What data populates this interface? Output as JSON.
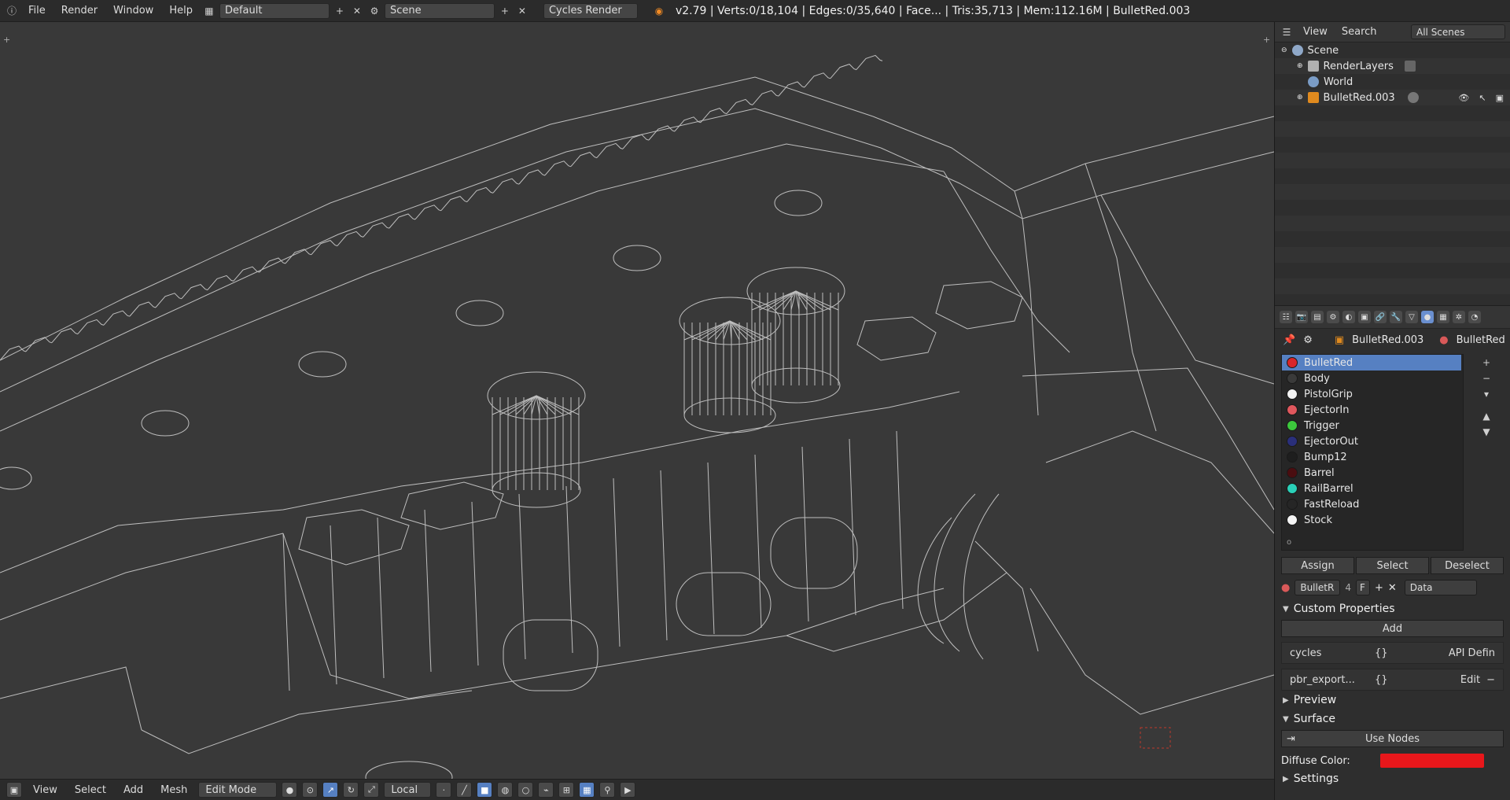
{
  "topbar": {
    "menus": [
      "File",
      "Render",
      "Window",
      "Help"
    ],
    "layout": "Default",
    "scene": "Scene",
    "engine": "Cycles Render",
    "stats": "v2.79 | Verts:0/18,104 | Edges:0/35,640 | Face... | Tris:35,713 | Mem:112.16M | BulletRed.003"
  },
  "outliner": {
    "menus": [
      "View",
      "Search"
    ],
    "scope": "All Scenes",
    "items": [
      {
        "label": "Scene"
      },
      {
        "label": "RenderLayers"
      },
      {
        "label": "World"
      },
      {
        "label": "BulletRed.003"
      }
    ]
  },
  "properties": {
    "context_object": "BulletRed.003",
    "context_material": "BulletRed",
    "materials": [
      {
        "label": "BulletRed",
        "color": "#d8262a"
      },
      {
        "label": "Body",
        "color": "#3a3a3a"
      },
      {
        "label": "PistolGrip",
        "color": "#f2f2f2"
      },
      {
        "label": "EjectorIn",
        "color": "#e0575d"
      },
      {
        "label": "Trigger",
        "color": "#3cc83c"
      },
      {
        "label": "EjectorOut",
        "color": "#2a2f7a"
      },
      {
        "label": "Bump12",
        "color": "#1e1e1e"
      },
      {
        "label": "Barrel",
        "color": "#4a0d10"
      },
      {
        "label": "RailBarrel",
        "color": "#2ad0b8"
      },
      {
        "label": "FastReload",
        "color": "#262626"
      },
      {
        "label": "Stock",
        "color": "#f5f5f5"
      }
    ],
    "buttons": {
      "assign": "Assign",
      "select": "Select",
      "deselect": "Deselect"
    },
    "datablock": {
      "name": "BulletR",
      "users": "4",
      "fake": "F",
      "link": "Data"
    },
    "custom_props": {
      "title": "Custom Properties",
      "add": "Add",
      "rows": [
        {
          "name": "cycles",
          "value": "{}",
          "extra": "API Defin"
        },
        {
          "name": "pbr_export...",
          "value": "{}",
          "extra": "Edit"
        }
      ]
    },
    "preview": "Preview",
    "surface": "Surface",
    "use_nodes": "Use Nodes",
    "diffuse_label": "Diffuse Color:",
    "diffuse_color": "#e8171b",
    "settings": "Settings"
  },
  "bottombar": {
    "menus": [
      "View",
      "Select",
      "Add",
      "Mesh"
    ],
    "mode": "Edit Mode",
    "pivot": "Local"
  }
}
